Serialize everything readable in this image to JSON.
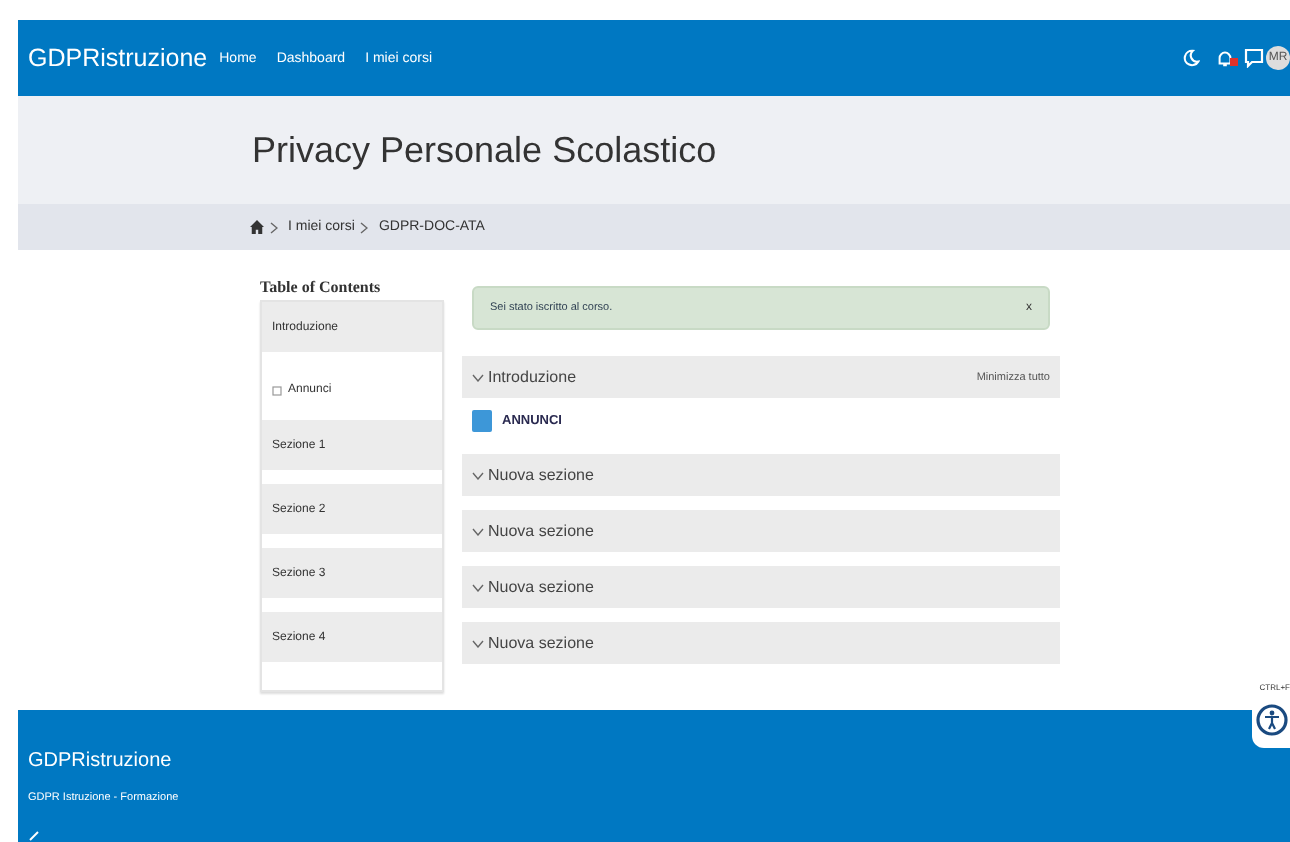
{
  "navbar": {
    "brand": "GDPRistruzione",
    "links": [
      "Home",
      "Dashboard",
      "I miei corsi"
    ],
    "avatar": "MR",
    "notifications_badge": true
  },
  "page_header": {
    "title": "Privacy Personale Scolastico"
  },
  "breadcrumb": [
    "I miei corsi",
    "GDPR-DOC-ATA"
  ],
  "toc": {
    "title": "Table of Contents",
    "items": [
      {
        "label": "Introduzione",
        "kind": "section"
      },
      {
        "label": "Annunci",
        "kind": "activity"
      },
      {
        "label": "Sezione 1",
        "kind": "section"
      },
      {
        "label": "Sezione 2",
        "kind": "section"
      },
      {
        "label": "Sezione 3",
        "kind": "section"
      },
      {
        "label": "Sezione 4",
        "kind": "section"
      }
    ]
  },
  "alert": {
    "message": "Sei stato iscritto al corso.",
    "close": "x"
  },
  "sections": [
    {
      "title": "Introduzione",
      "action": "Minimizza tutto",
      "activities": [
        "ANNUNCI"
      ]
    },
    {
      "title": "Nuova sezione"
    },
    {
      "title": "Nuova sezione"
    },
    {
      "title": "Nuova sezione"
    },
    {
      "title": "Nuova sezione"
    }
  ],
  "accessibility": {
    "shortcut": "CTRL+F"
  },
  "footer": {
    "brand": "GDPRistruzione",
    "tagline": "GDPR Istruzione - Formazione"
  }
}
